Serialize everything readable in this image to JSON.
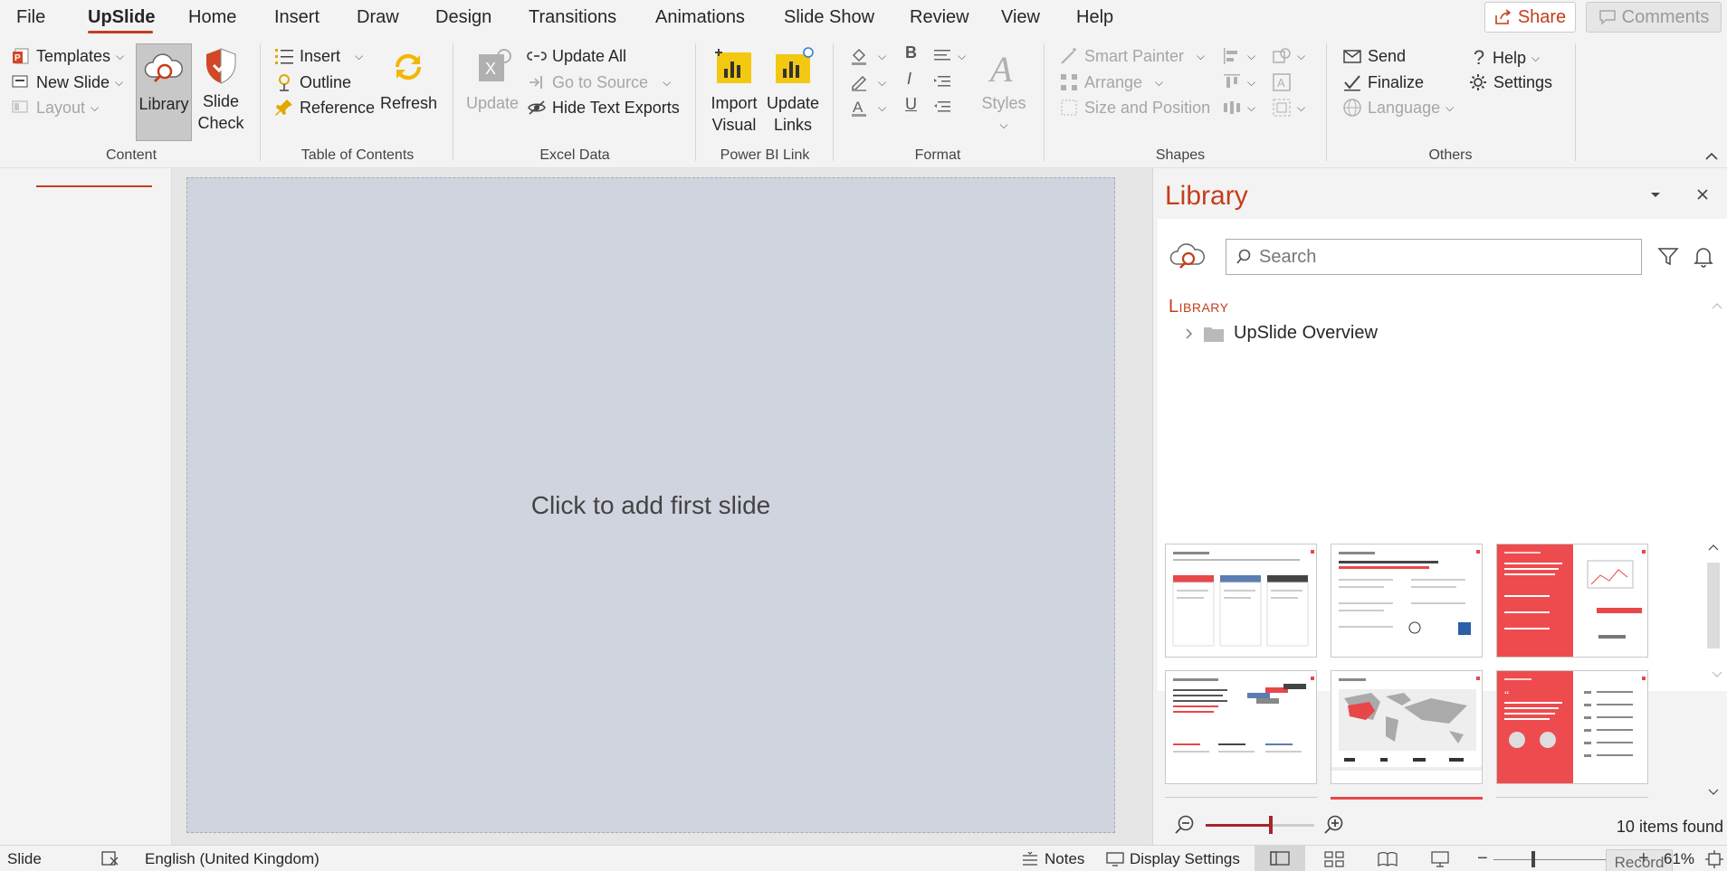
{
  "menu": {
    "tabs": [
      "File",
      "UpSlide",
      "Home",
      "Insert",
      "Draw",
      "Design",
      "Transitions",
      "Animations",
      "Slide Show",
      "Review",
      "View",
      "Help"
    ],
    "active_tab": "UpSlide",
    "share_label": "Share",
    "comments_label": "Comments"
  },
  "ribbon": {
    "content": {
      "group_label": "Content",
      "templates": "Templates",
      "new_slide": "New Slide",
      "layout": "Layout",
      "library": "Library",
      "slide_check_1": "Slide",
      "slide_check_2": "Check"
    },
    "toc": {
      "group_label": "Table of Contents",
      "insert": "Insert",
      "outline": "Outline",
      "reference": "Reference",
      "refresh": "Refresh"
    },
    "excel": {
      "group_label": "Excel Data",
      "update": "Update",
      "update_all": "Update All",
      "go_to_source": "Go to Source",
      "hide_text_exports": "Hide Text Exports"
    },
    "powerbi": {
      "group_label": "Power BI Link",
      "import_1": "Import",
      "import_2": "Visual",
      "update_1": "Update",
      "update_2": "Links"
    },
    "format": {
      "group_label": "Format",
      "bold": "B",
      "italic": "I",
      "underline": "U",
      "styles": "Styles"
    },
    "shapes": {
      "group_label": "Shapes",
      "smart_painter": "Smart Painter",
      "arrange": "Arrange",
      "size_position": "Size and Position"
    },
    "others": {
      "group_label": "Others",
      "send": "Send",
      "finalize": "Finalize",
      "language": "Language",
      "help": "Help",
      "settings": "Settings"
    }
  },
  "canvas": {
    "placeholder": "Click to add first slide"
  },
  "library": {
    "title": "Library",
    "search_placeholder": "Search",
    "section_heading": "Library",
    "tree_item": "UpSlide Overview",
    "items_found": "10 items found",
    "zoom_level": 0.6
  },
  "statusbar": {
    "view": "Slide",
    "language": "English (United Kingdom)",
    "notes": "Notes",
    "display_settings": "Display Settings",
    "zoom": "61%",
    "record": "Record"
  },
  "colors": {
    "accent": "#c43e1c",
    "powerbi_yellow": "#f2c811",
    "slide_bg": "#d0d4df"
  }
}
